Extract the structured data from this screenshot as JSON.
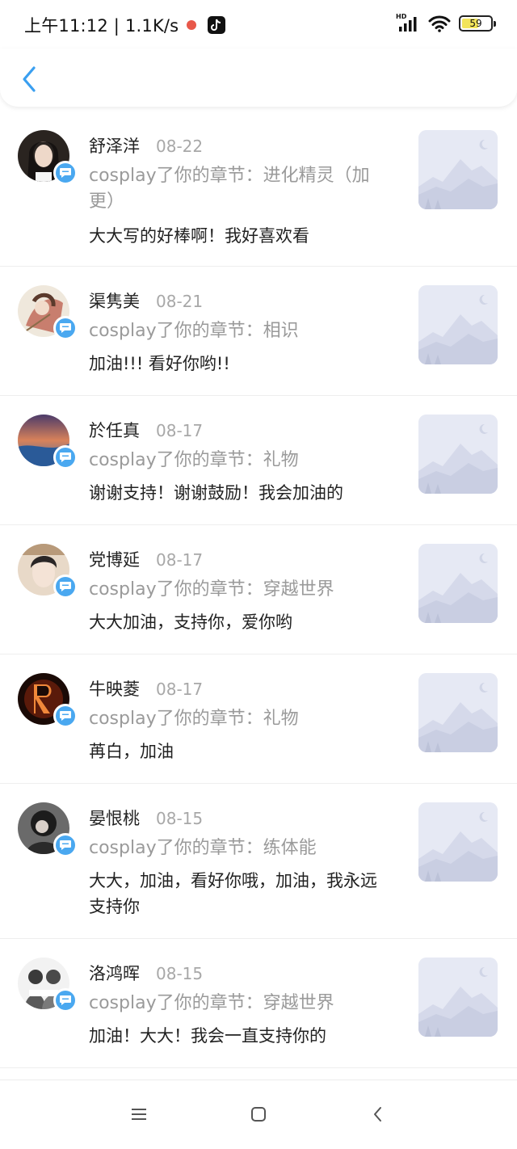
{
  "status_bar": {
    "time_speed": "上午11:12 | 1.1K/s",
    "hd_label": "HD",
    "battery_percent": "59",
    "battery_level": 0.59,
    "icons": [
      "recording-dot-icon",
      "tiktok-icon",
      "signal-icon",
      "wifi-icon",
      "battery-icon"
    ]
  },
  "header": {
    "back_icon": "chevron-left-icon"
  },
  "comments": [
    {
      "name": "舒泽洋",
      "date": "08-22",
      "subtitle": "cosplay了你的章节：进化精灵（加更）",
      "comment": "大大写的好棒啊！我好喜欢看"
    },
    {
      "name": "渠隽美",
      "date": "08-21",
      "subtitle": "cosplay了你的章节：相识",
      "comment": "加油!!! 看好你哟!!"
    },
    {
      "name": "於任真",
      "date": "08-17",
      "subtitle": "cosplay了你的章节：礼物",
      "comment": "谢谢支持！谢谢鼓励！我会加油的"
    },
    {
      "name": "党博延",
      "date": "08-17",
      "subtitle": "cosplay了你的章节：穿越世界",
      "comment": "大大加油，支持你，爱你哟"
    },
    {
      "name": "牛映菱",
      "date": "08-17",
      "subtitle": "cosplay了你的章节：礼物",
      "comment": "苒白，加油"
    },
    {
      "name": "晏恨桃",
      "date": "08-15",
      "subtitle": "cosplay了你的章节：练体能",
      "comment": "大大，加油，看好你哦，加油，我永远支持你"
    },
    {
      "name": "洛鸿晖",
      "date": "08-15",
      "subtitle": "cosplay了你的章节：穿越世界",
      "comment": "加油！大大！我会一直支持你的"
    }
  ],
  "nav": {
    "icons": [
      "menu-icon",
      "home-square-icon",
      "back-triangle-icon"
    ]
  },
  "colors": {
    "accent": "#4aa8f0",
    "badge": "#4aa8f0",
    "thumb_bg": "#e6e9f4"
  }
}
